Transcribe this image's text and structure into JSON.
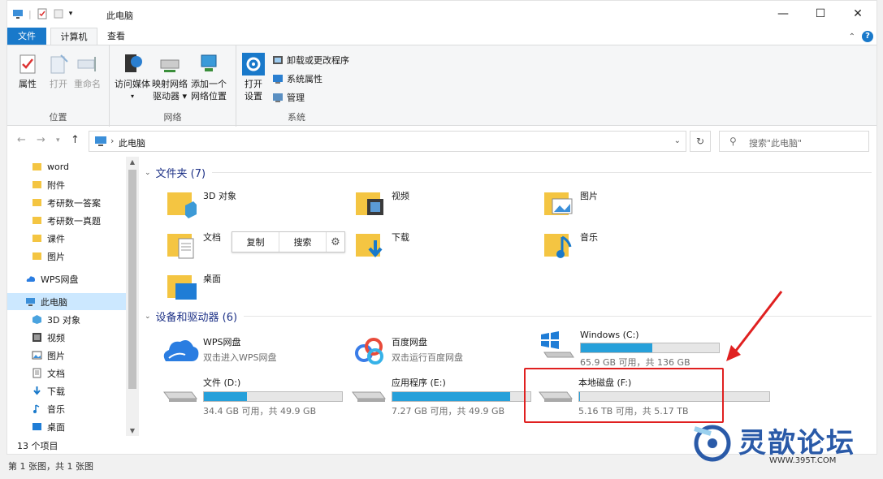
{
  "window": {
    "title": "此电脑"
  },
  "controls": {
    "minimize": "—",
    "maximize": "☐",
    "close": "✕"
  },
  "tabs": {
    "file": "文件",
    "computer": "计算机",
    "view": "查看"
  },
  "ribbon": {
    "location": {
      "label": "位置",
      "properties": "属性",
      "open": "打开",
      "rename": "重命名"
    },
    "network": {
      "label": "网络",
      "access_media": "访问媒体",
      "map_drive_1": "映射网络",
      "map_drive_2": "驱动器 ▾",
      "add_location_1": "添加一个",
      "add_location_2": "网络位置"
    },
    "system": {
      "label": "系统",
      "open_settings_1": "打开",
      "open_settings_2": "设置",
      "uninstall": "卸载或更改程序",
      "system_properties": "系统属性",
      "manage": "管理"
    }
  },
  "address": {
    "sep": "›",
    "path": "此电脑",
    "refresh": "↻",
    "search_placeholder": "搜索\"此电脑\""
  },
  "sidebar": {
    "items": [
      {
        "label": "word"
      },
      {
        "label": "附件"
      },
      {
        "label": "考研数一答案"
      },
      {
        "label": "考研数一真题"
      },
      {
        "label": "课件"
      },
      {
        "label": "图片"
      },
      {
        "label": "WPS网盘"
      },
      {
        "label": "此电脑"
      },
      {
        "label": "3D 对象"
      },
      {
        "label": "视频"
      },
      {
        "label": "图片"
      },
      {
        "label": "文档"
      },
      {
        "label": "下载"
      },
      {
        "label": "音乐"
      },
      {
        "label": "桌面"
      }
    ]
  },
  "status": {
    "items": "13 个项目",
    "bottom": "第 1 张图，共 1 张图"
  },
  "folders": {
    "header": "文件夹 (7)",
    "items": [
      {
        "name": "3D 对象"
      },
      {
        "name": "视频"
      },
      {
        "name": "图片"
      },
      {
        "name": "文档"
      },
      {
        "name": "下载"
      },
      {
        "name": "音乐"
      },
      {
        "name": "桌面"
      }
    ]
  },
  "floating_toolbar": {
    "copy": "复制",
    "search": "搜索"
  },
  "drives": {
    "header": "设备和驱动器 (6)",
    "wps": {
      "name": "WPS网盘",
      "desc": "双击进入WPS网盘"
    },
    "baidu": {
      "name": "百度网盘",
      "desc": "双击运行百度网盘"
    },
    "c": {
      "name": "Windows (C:)",
      "info": "65.9 GB 可用，共 136 GB",
      "used_fraction": 0.52
    },
    "d": {
      "name": "文件 (D:)",
      "info": "34.4 GB 可用，共 49.9 GB",
      "used_fraction": 0.31
    },
    "e": {
      "name": "应用程序 (E:)",
      "info": "7.27 GB 可用，共 49.9 GB",
      "used_fraction": 0.85
    },
    "f": {
      "name": "本地磁盘 (F:)",
      "info": "5.16 TB 可用，共 5.17 TB",
      "used_fraction": 0.002
    }
  },
  "watermark": {
    "text": "灵歆论坛",
    "url": "WWW.395T.COM"
  },
  "colors": {
    "accent": "#1979ca",
    "bar_fill": "#26a0da",
    "highlight": "#e02020"
  }
}
